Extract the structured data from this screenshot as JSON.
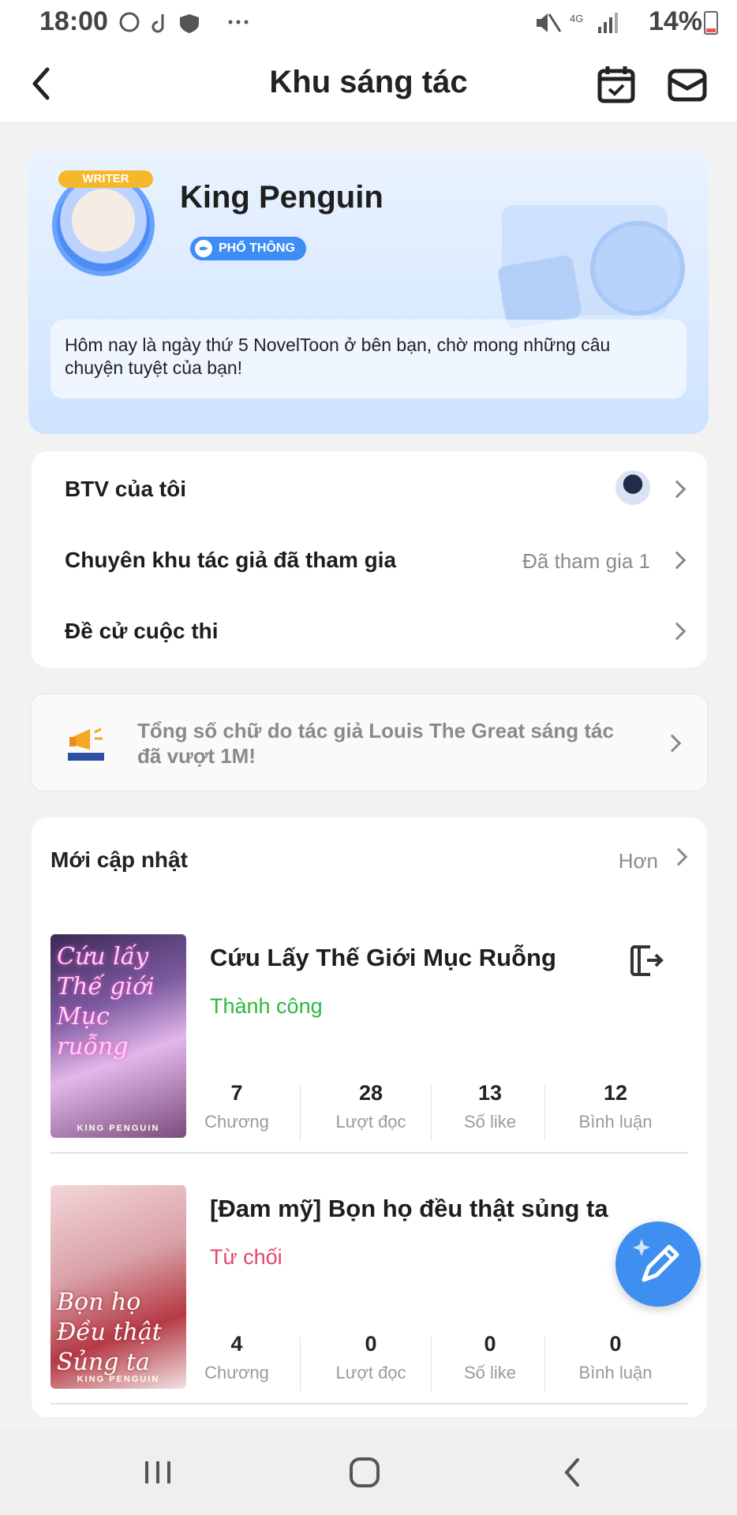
{
  "status_bar": {
    "time": "18:00",
    "battery_text": "14%",
    "network": "4G",
    "icons": [
      "whatsapp-icon",
      "tiktok-icon",
      "shield-icon",
      "more-icon",
      "mute-icon",
      "signal-icon",
      "battery-icon"
    ]
  },
  "header": {
    "title": "Khu sáng tác",
    "icons": [
      "back-icon",
      "calendar-icon",
      "mail-icon"
    ]
  },
  "profile": {
    "writer_tag": "WRITER",
    "name": "King Penguin",
    "badge": "PHỔ THÔNG",
    "message": "Hôm nay là ngày thứ 5 NovelToon ở bên bạn, chờ mong những câu chuyện tuyệt của bạn!"
  },
  "menu": {
    "items": [
      {
        "label": "BTV của tôi",
        "value": ""
      },
      {
        "label": "Chuyên khu tác giả đã tham gia",
        "value": "Đã tham gia 1"
      },
      {
        "label": "Đề cử cuộc thi",
        "value": ""
      }
    ]
  },
  "notice": {
    "text": "Tổng số chữ do tác giả Louis The Great sáng tác đã vượt 1M!"
  },
  "updates": {
    "title": "Mới cập nhật",
    "more_label": "Hơn",
    "books": [
      {
        "cover_title": "Cứu lấy Thế giới Mục ruỗng",
        "cover_author": "KING PENGUIN",
        "title": "Cứu Lấy Thế Giới Mục Ruỗng",
        "status": "Thành công",
        "status_color": "#2db83d",
        "stats": [
          {
            "value": "7",
            "label": "Chương"
          },
          {
            "value": "28",
            "label": "Lượt đọc"
          },
          {
            "value": "13",
            "label": "Số like"
          },
          {
            "value": "12",
            "label": "Bình luận"
          }
        ]
      },
      {
        "cover_title": "Bọn họ Đều thật Sủng ta",
        "cover_author": "KING PENGUIN",
        "title": "[Đam mỹ] Bọn họ đều thật sủng ta",
        "status": "Từ chối",
        "status_color": "#e8456b",
        "stats": [
          {
            "value": "4",
            "label": "Chương"
          },
          {
            "value": "0",
            "label": "Lượt đọc"
          },
          {
            "value": "0",
            "label": "Số like"
          },
          {
            "value": "0",
            "label": "Bình luận"
          }
        ]
      }
    ]
  },
  "colors": {
    "accent": "#3e8ff0",
    "success": "#2db83d",
    "rejected": "#e8456b"
  }
}
